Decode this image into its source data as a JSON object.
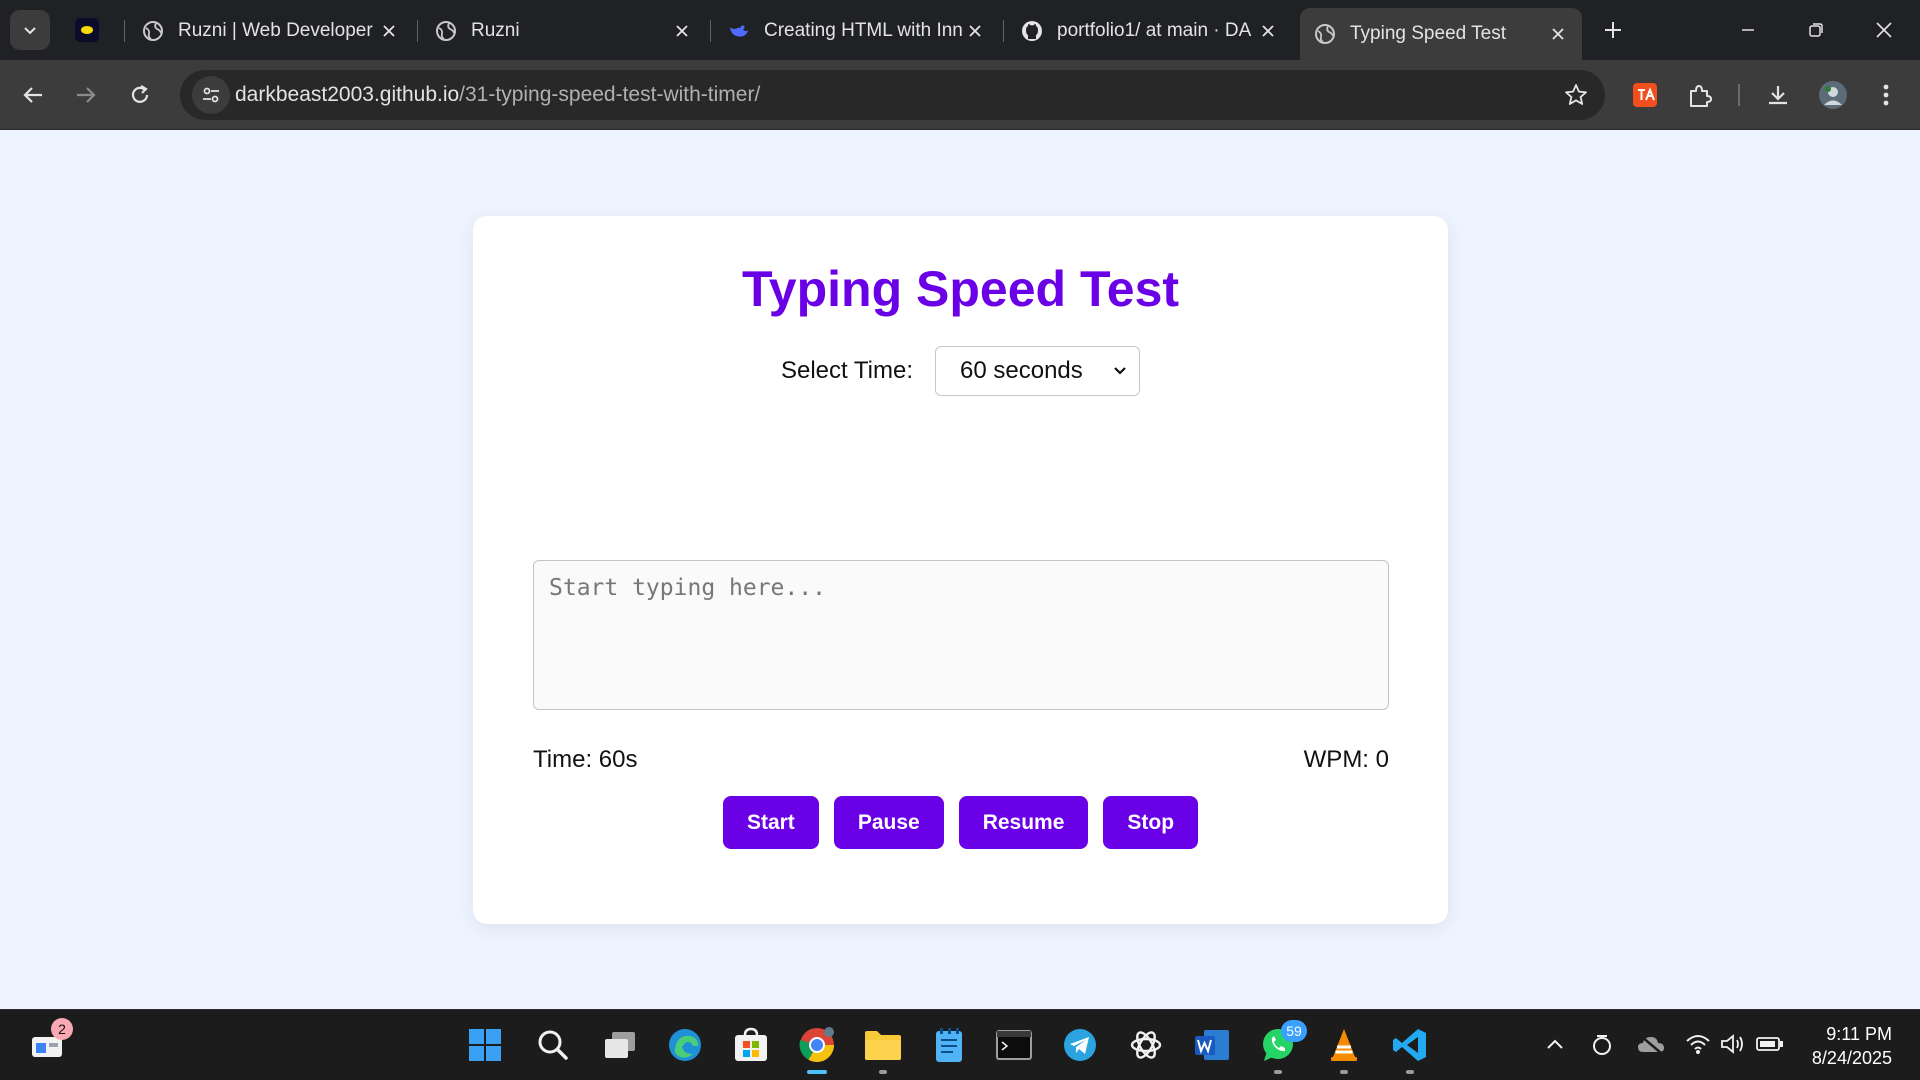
{
  "browser": {
    "tabs": [
      {
        "title": "Ruzni | Web Developer",
        "icon": "globe-icon"
      },
      {
        "title": "Ruzni",
        "icon": "globe-icon"
      },
      {
        "title": "Creating HTML with Inn",
        "icon": "deepseek-whale-icon"
      },
      {
        "title": "portfolio1/ at main · DA",
        "icon": "github-icon"
      },
      {
        "title": "Typing Speed Test",
        "icon": "globe-icon",
        "active": true
      }
    ],
    "url_host": "darkbeast2003.github.io",
    "url_path": "/31-typing-speed-test-with-timer/"
  },
  "page": {
    "title": "Typing Speed Test",
    "select_label": "Select Time:",
    "selected_time": "60 seconds",
    "typing_placeholder": "Start typing here...",
    "time_text": "Time: 60s",
    "wpm_text": "WPM: 0",
    "buttons": {
      "start": "Start",
      "pause": "Pause",
      "resume": "Resume",
      "stop": "Stop"
    },
    "accent_color": "#6a00e6"
  },
  "taskbar": {
    "widgets_badge": "2",
    "whatsapp_badge": "59",
    "time": "9:11 PM",
    "date": "8/24/2025"
  }
}
